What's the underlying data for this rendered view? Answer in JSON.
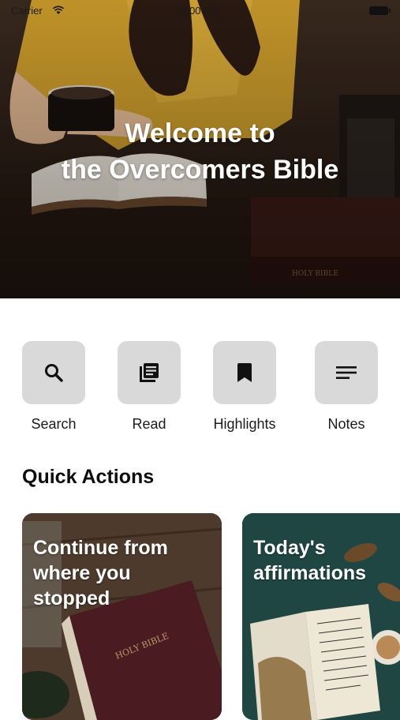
{
  "status_bar": {
    "carrier": "Carrier",
    "time": "12:00 PM"
  },
  "hero": {
    "title_line1": "Welcome to",
    "title_line2": "the Overcomers Bible"
  },
  "shortcuts": [
    {
      "label": "Search",
      "icon": "search-icon"
    },
    {
      "label": "Read",
      "icon": "book-pages-icon"
    },
    {
      "label": "Highlights",
      "icon": "bookmark-icon"
    },
    {
      "label": "Notes",
      "icon": "notes-icon"
    }
  ],
  "quick_actions": {
    "title": "Quick Actions",
    "cards": [
      {
        "line1": "Continue from",
        "line2": "where you",
        "line3": "stopped",
        "book_text": "HOLY BIBLE"
      },
      {
        "line1": "Today's",
        "line2": "affirmations"
      }
    ]
  },
  "colors": {
    "tile": "#d9d9d9",
    "background": "#ffffff",
    "text": "#111111"
  }
}
